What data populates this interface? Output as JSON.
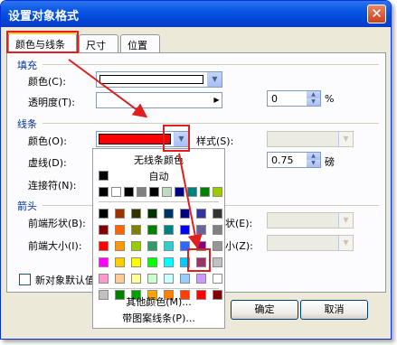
{
  "dialog": {
    "title": "设置对象格式",
    "close_glyph": "✕"
  },
  "tabs": [
    {
      "label": "颜色与线条",
      "active": true
    },
    {
      "label": "尺寸",
      "active": false
    },
    {
      "label": "位置",
      "active": false
    }
  ],
  "fill": {
    "section": "填充",
    "color_label": "颜色(C):",
    "color_value": "#ffffff",
    "transparency_label": "透明度(T):",
    "transparency_value": "0",
    "transparency_unit": "%"
  },
  "line": {
    "section": "线条",
    "color_label": "颜色(O):",
    "color_value": "#ff0000",
    "style_label": "样式(S):",
    "dash_label": "虚线(D):",
    "weight_value": "0.75",
    "weight_unit": "磅",
    "connector_label": "连接符(N):"
  },
  "arrows": {
    "section": "箭头",
    "begin_style_label": "前端形状(B):",
    "begin_size_label": "前端大小(I):",
    "end_style_label": "状(E):",
    "end_size_label": "小(Z):"
  },
  "footer": {
    "default_checkbox_label": "新对象默认值",
    "ok_label": "确定",
    "cancel_label": "取消"
  },
  "palette": {
    "no_line": "无线条颜色",
    "automatic": "自动",
    "more_colors": "其他颜色(M)...",
    "patterned_lines": "带图案线条(P)...",
    "recent_colors": [
      "#000000",
      "#ffffff",
      "#000000",
      "#808080",
      "#000000",
      "#c0dcc0",
      "#000080",
      "#008080",
      "#008000",
      "#99cc00"
    ],
    "grid": [
      [
        "#000000",
        "#993300",
        "#333300",
        "#003300",
        "#003366",
        "#000080",
        "#333399",
        "#333333"
      ],
      [
        "#800000",
        "#ff6600",
        "#808000",
        "#008000",
        "#008080",
        "#0000ff",
        "#666699",
        "#808080"
      ],
      [
        "#ff0000",
        "#ff9900",
        "#99cc00",
        "#339966",
        "#33cccc",
        "#3366ff",
        "#800080",
        "#969696"
      ],
      [
        "#ff00ff",
        "#ffcc00",
        "#ffff00",
        "#00ff00",
        "#00ffff",
        "#00ccff",
        "#993366",
        "#c0c0c0"
      ],
      [
        "#ff99cc",
        "#ffcc99",
        "#ffff99",
        "#ccffcc",
        "#ccffff",
        "#99ccff",
        "#cc99ff",
        "#ffffff"
      ],
      [
        "#c0c0c0",
        "#008000",
        "#00a000",
        "#ffa500",
        "#ff8000",
        "#ff4000",
        "#ff0000",
        "#800000"
      ]
    ],
    "selected_row": 4,
    "selected_col": 6
  },
  "colors": {
    "highlight": "#e02020",
    "title_bar": "#0a55e4",
    "section_text": "#003399"
  }
}
